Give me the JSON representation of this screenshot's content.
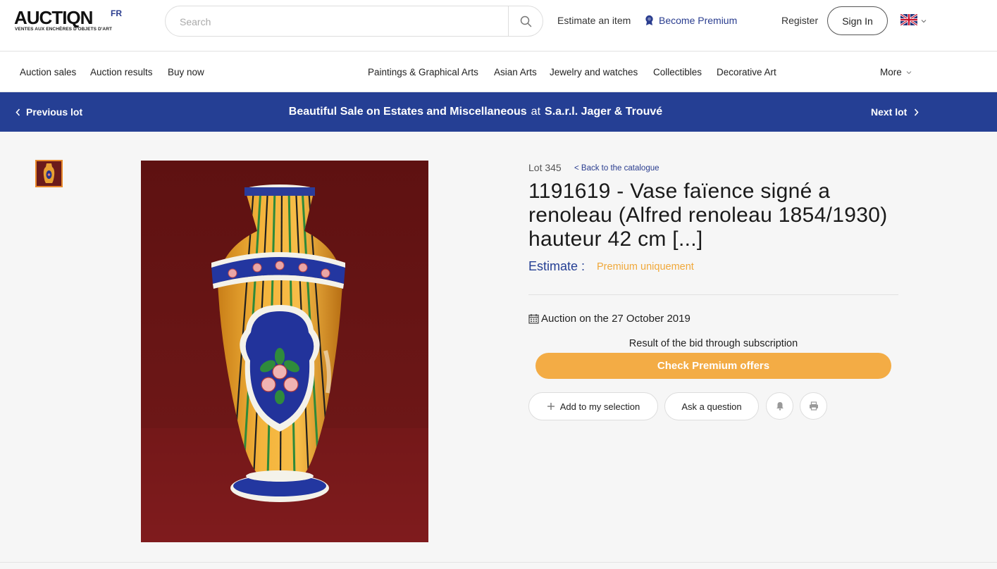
{
  "header": {
    "logo_text": "AUCTIQN",
    "logo_superscript": "FR",
    "logo_tagline": "VENTES AUX ENCHÈRES D'OBJETS D'ART",
    "search_placeholder": "Search",
    "estimate_link": "Estimate an item",
    "premium_link": "Become Premium",
    "register_link": "Register",
    "signin_label": "Sign In",
    "language": "English"
  },
  "nav": {
    "left": [
      "Auction sales",
      "Auction results",
      "Buy now"
    ],
    "categories": [
      "Paintings & Graphical Arts",
      "Asian Arts",
      "Jewelry and watches",
      "Collectibles",
      "Decorative Art"
    ],
    "more_label": "More"
  },
  "lotbar": {
    "previous_label": "Previous lot",
    "sale_name": "Beautiful Sale on Estates and Miscellaneous",
    "at_label": "at",
    "auction_house": "S.a.r.l. Jager & Trouvé",
    "next_label": "Next lot"
  },
  "lot": {
    "lot_number": "Lot 345",
    "back_link": "< Back to the catalogue",
    "title": "1191619 - Vase faïence signé a renoleau (Alfred renoleau 1854/1930) hauteur 42 cm [...]",
    "estimate_label": "Estimate :",
    "estimate_value": "Premium uniquement",
    "auction_date": "Auction on the 27 October 2019",
    "result_text": "Result of the bid through subscription",
    "premium_button": "Check Premium offers",
    "add_selection": "Add to my selection",
    "ask_question": "Ask a question"
  },
  "colors": {
    "brand_blue": "#253f94",
    "premium_orange": "#f3ac45",
    "thumb_border": "#e98a2b"
  }
}
